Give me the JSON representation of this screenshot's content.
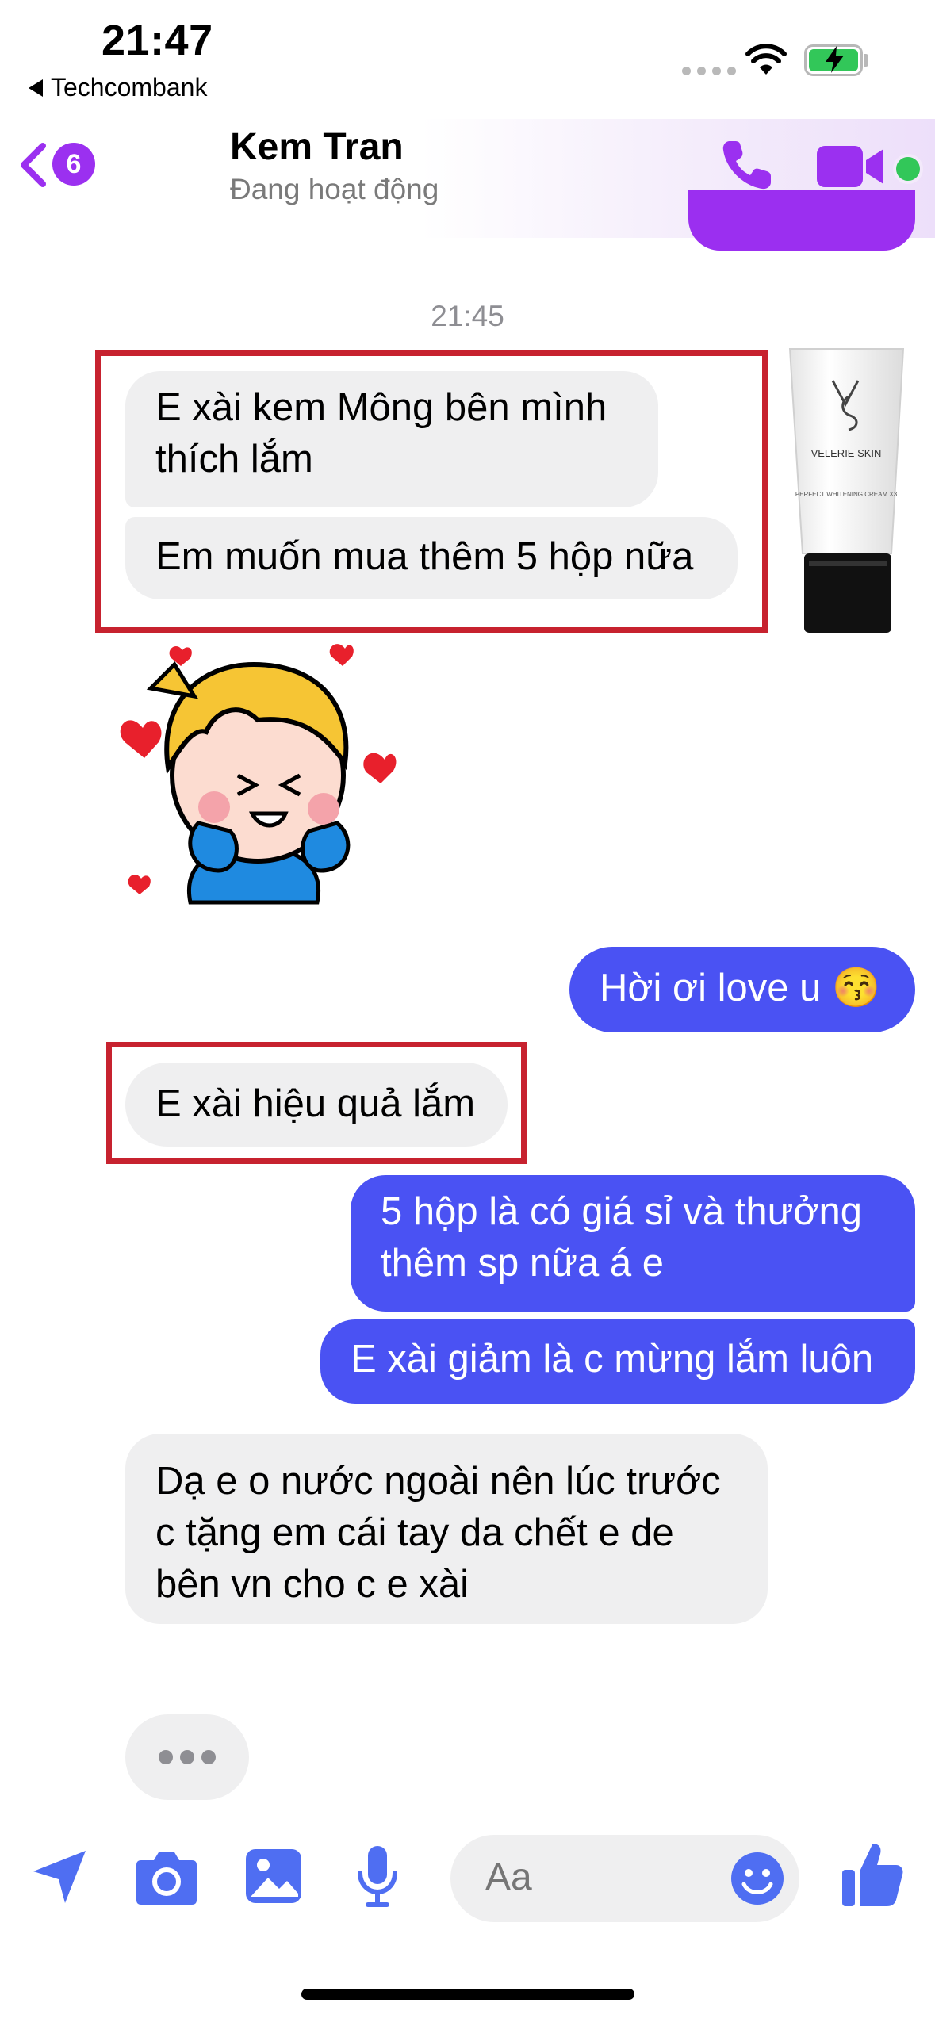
{
  "status_bar": {
    "time": "21:47",
    "back_app": "Techcombank"
  },
  "header": {
    "unread_count": "6",
    "contact_name": "Kem Tran",
    "contact_status": "Đang hoạt động"
  },
  "chat": {
    "timestamp": "21:45",
    "messages": [
      {
        "side": "incoming",
        "text": "E xài kem Mông bên mình thích lắm"
      },
      {
        "side": "incoming",
        "text": "Em muốn mua thêm 5 hộp nữa"
      },
      {
        "side": "outgoing",
        "text": "Hời ơi love u 😚"
      },
      {
        "side": "incoming",
        "text": "E xài hiệu quả lắm"
      },
      {
        "side": "outgoing",
        "text": "5 hộp là có giá sỉ và thưởng thêm sp nữa á e"
      },
      {
        "side": "outgoing",
        "text": "E xài giảm là c mừng lắm luôn"
      },
      {
        "side": "incoming",
        "text": "Dạ e o nước ngoài nên lúc trước c tặng em cái tay da chết e de bên vn cho c e xài"
      }
    ],
    "product": {
      "brand": "VELERIE SKIN",
      "name": "PERFECT WHITENING CREAM X3"
    }
  },
  "composer": {
    "placeholder": "Aa"
  },
  "colors": {
    "accent": "#9b30f0",
    "outgoing_bubble": "#4a52f3",
    "incoming_bubble": "#efeff0",
    "highlight": "#c7222f",
    "online": "#32c759"
  },
  "icons": [
    "send-icon",
    "camera-icon",
    "gallery-icon",
    "mic-icon",
    "emoji-icon",
    "like-icon",
    "phone-icon",
    "video-icon",
    "back-chevron-icon"
  ]
}
